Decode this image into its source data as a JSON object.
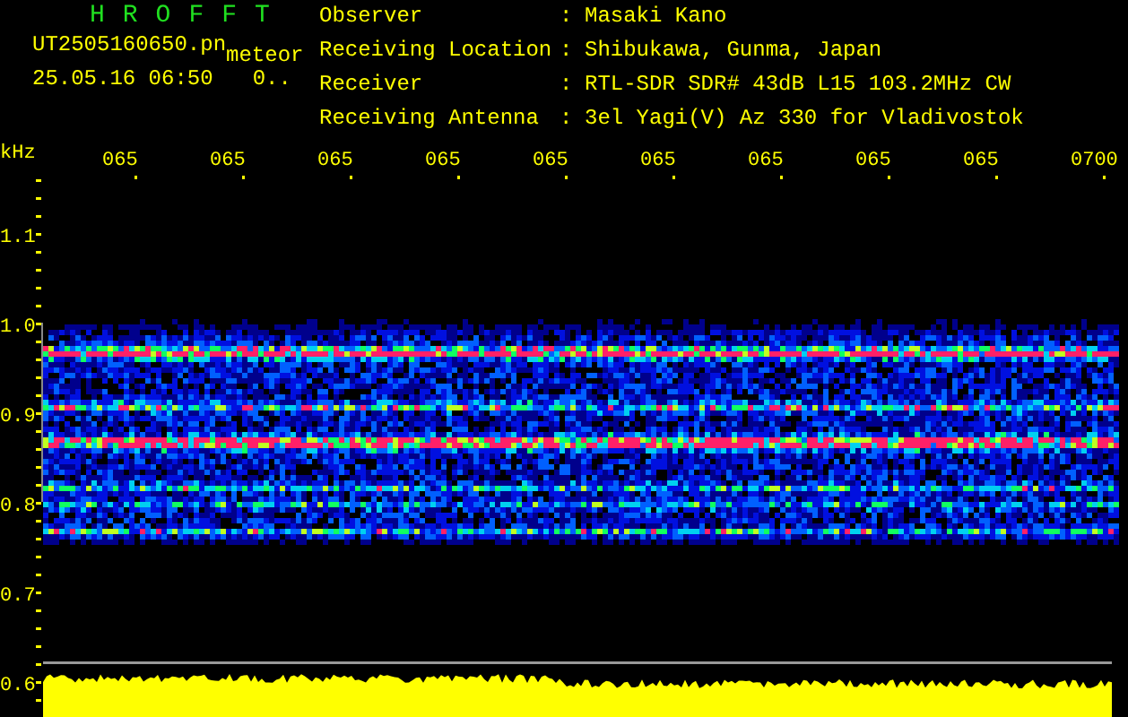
{
  "header": {
    "title": "HROFFT",
    "filename": "UT2505160650.pn",
    "mode": "meteor",
    "datetime": "25.05.16 06:50",
    "count": "0..",
    "fields": [
      {
        "label": "Observer",
        "sep": ":",
        "value": "Masaki Kano"
      },
      {
        "label": "Receiving Location",
        "sep": ":",
        "value": "Shibukawa, Gunma, Japan"
      },
      {
        "label": "Receiver",
        "sep": ":",
        "value": "RTL-SDR SDR# 43dB L15 103.2MHz CW"
      },
      {
        "label": "Receiving Antenna",
        "sep": ":",
        "value": "3el Yagi(V) Az 330 for Vladivostok"
      }
    ]
  },
  "plot": {
    "unit": "kHz",
    "time_labels": [
      "065",
      "065",
      "065",
      "065",
      "065",
      "065",
      "065",
      "065",
      "065",
      "0700"
    ],
    "frequency_labels": [
      "1.1",
      "1.0",
      "0.9",
      "0.8",
      "0.7",
      "0.6"
    ]
  }
}
